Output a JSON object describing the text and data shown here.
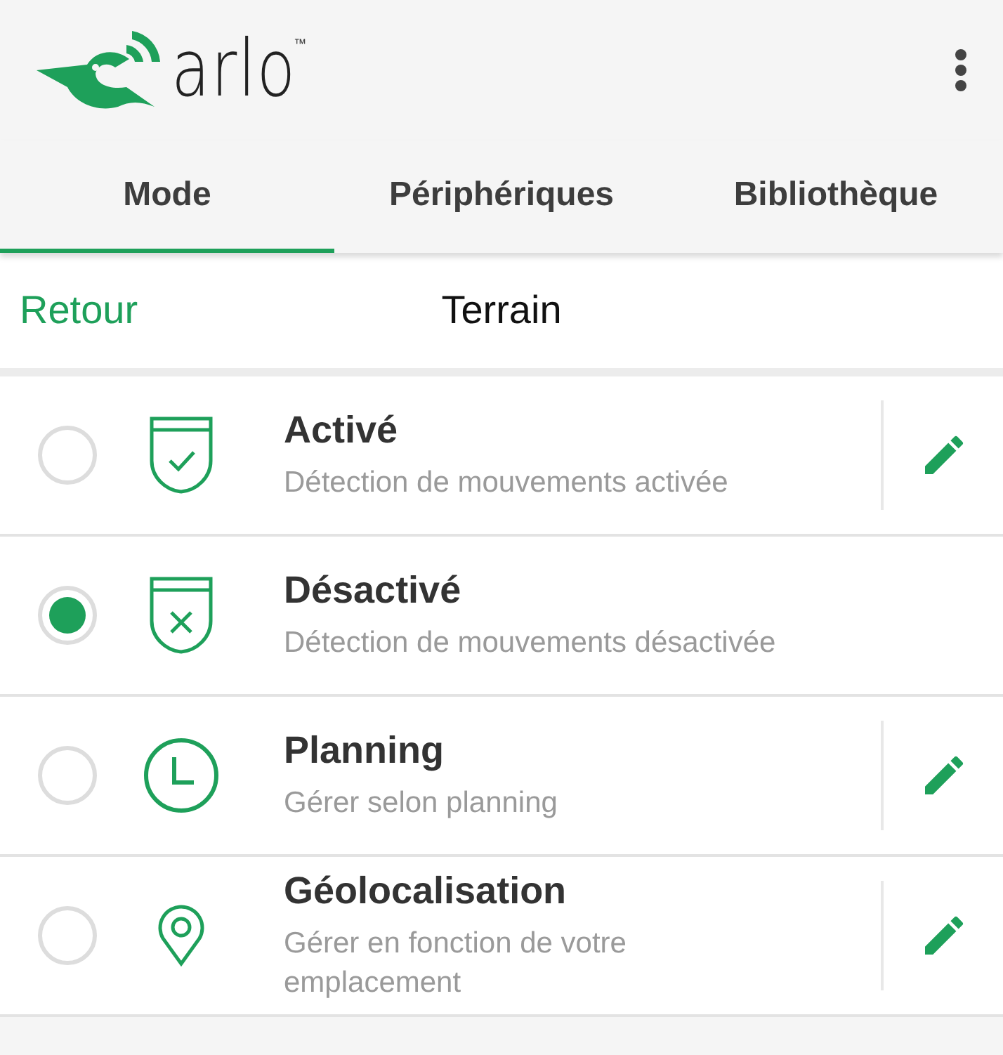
{
  "logo": {
    "text": "arlo",
    "mark": "™"
  },
  "tabs": [
    {
      "label": "Mode",
      "selected": true
    },
    {
      "label": "Périphériques",
      "selected": false
    },
    {
      "label": "Bibliothèque",
      "selected": false
    }
  ],
  "subheader": {
    "back": "Retour",
    "title": "Terrain"
  },
  "modes": [
    {
      "kind": "shield-check",
      "title": "Activé",
      "description": "Détection de mouvements activée",
      "selected": false,
      "editable": true
    },
    {
      "kind": "shield-x",
      "title": "Désactivé",
      "description": "Détection de mouvements désactivée",
      "selected": true,
      "editable": false
    },
    {
      "kind": "clock",
      "title": "Planning",
      "description": "Gérer selon planning",
      "selected": false,
      "editable": true
    },
    {
      "kind": "pin",
      "title": "Géolocalisation",
      "description": "Gérer en fonction de votre\nemplacement",
      "selected": false,
      "editable": true
    }
  ]
}
